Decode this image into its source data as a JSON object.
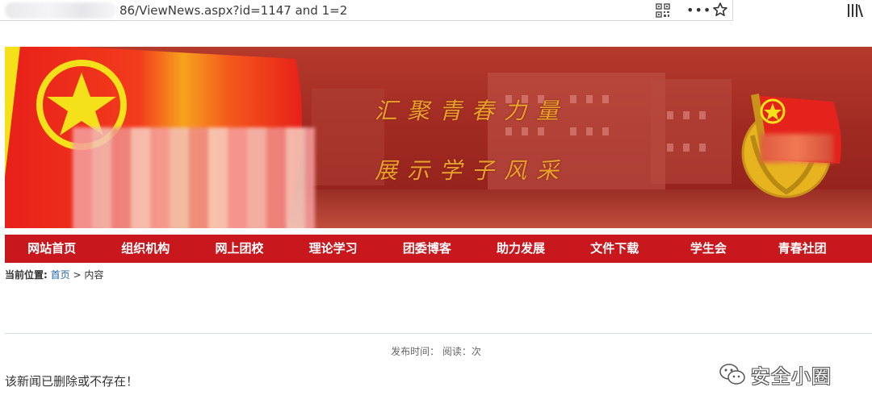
{
  "browser": {
    "url_visible": "86/ViewNews.aspx?id=1147 and 1=2",
    "icons": [
      "qr-code-icon",
      "more-dots-icon",
      "bookmark-star-icon",
      "library-icon"
    ]
  },
  "banner": {
    "slogan_line1": "汇聚青春力量",
    "slogan_line2": "展示学子风采",
    "colors": {
      "flag_red": "#e8201a",
      "slogan_gold": "#e8a12c",
      "nav_red": "#c8171d"
    }
  },
  "nav": {
    "items": [
      "网站首页",
      "组织机构",
      "网上团校",
      "理论学习",
      "团委博客",
      "助力发展",
      "文件下载",
      "学生会",
      "青春社团"
    ]
  },
  "breadcrumb": {
    "label": "当前位置:",
    "home": "首页",
    "separator": ">",
    "current": "内容"
  },
  "article": {
    "meta": "发布时间： 阅读：次",
    "message": "该新闻已删除或不存在！"
  },
  "watermark": {
    "text": "安全小圈"
  }
}
